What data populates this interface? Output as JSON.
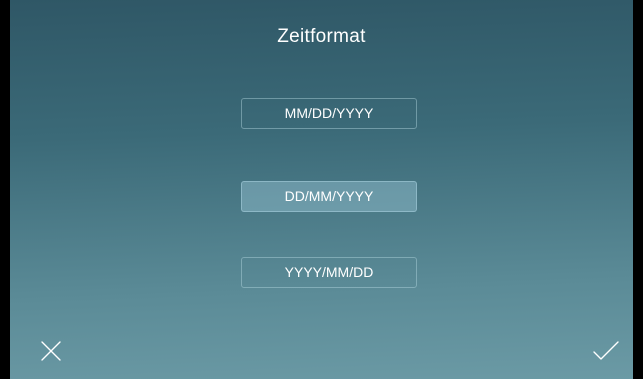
{
  "screen": {
    "title": "Zeitformat"
  },
  "options": [
    {
      "label": "MM/DD/YYYY",
      "selected": false
    },
    {
      "label": "DD/MM/YYYY",
      "selected": true
    },
    {
      "label": "YYYY/MM/DD",
      "selected": false
    }
  ],
  "actions": {
    "cancel_icon": "close-icon",
    "confirm_icon": "checkmark-icon"
  },
  "colors": {
    "gradient_top": "#2f5766",
    "gradient_bottom": "#6b9aa5",
    "text": "#ffffff",
    "selected_fill": "#96c3d2"
  }
}
